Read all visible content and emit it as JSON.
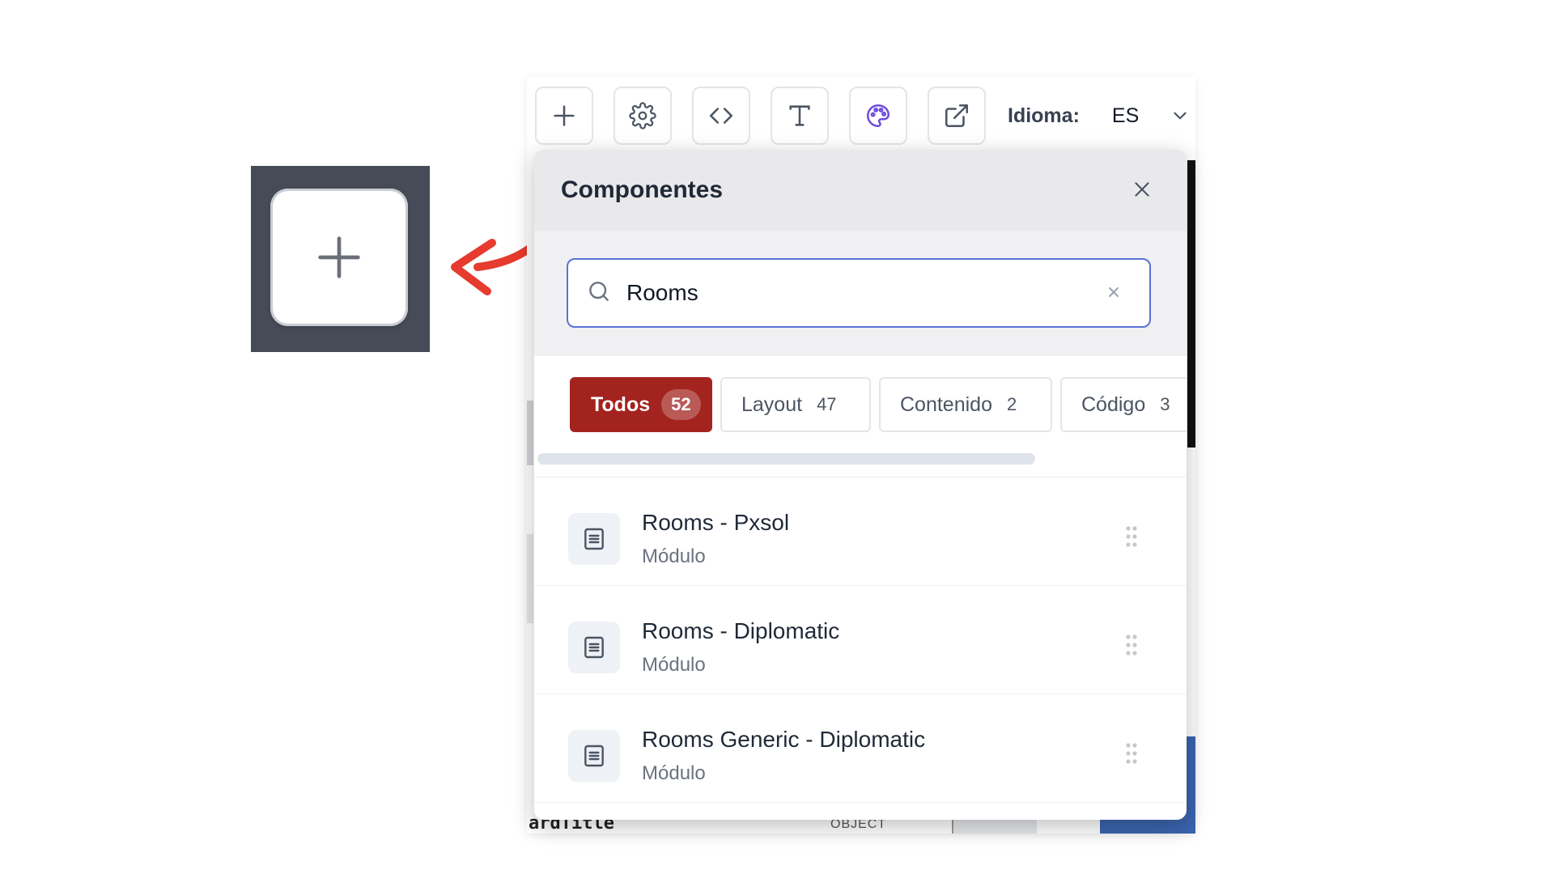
{
  "toolbar": {
    "buttons": [
      {
        "name": "add",
        "icon": "plus-icon"
      },
      {
        "name": "settings",
        "icon": "gear-icon"
      },
      {
        "name": "code",
        "icon": "code-icon"
      },
      {
        "name": "text",
        "icon": "text-icon"
      },
      {
        "name": "theme",
        "icon": "palette-icon",
        "accent": "#6d4ee0"
      },
      {
        "name": "open-external",
        "icon": "external-link-icon"
      }
    ],
    "language_label": "Idioma:",
    "language_value": "ES"
  },
  "panel": {
    "title": "Componentes",
    "search": {
      "value": "Rooms",
      "placeholder": ""
    },
    "tabs": [
      {
        "label": "Todos",
        "count": "52",
        "active": true
      },
      {
        "label": "Layout",
        "count": "47",
        "active": false
      },
      {
        "label": "Contenido",
        "count": "2",
        "active": false
      },
      {
        "label": "Código",
        "count": "3",
        "active": false
      }
    ],
    "items": [
      {
        "title": "Rooms - Pxsol",
        "subtitle": "Módulo"
      },
      {
        "title": "Rooms - Diplomatic",
        "subtitle": "Módulo"
      },
      {
        "title": "Rooms Generic - Diplomatic",
        "subtitle": "Módulo"
      }
    ]
  },
  "background": {
    "code_text": "ardTitle",
    "type_text": "OBJECT"
  },
  "colors": {
    "active_tab": "#a3231f",
    "search_border": "#5b72d4",
    "arrow": "#e63b2e",
    "callout_bg": "#474b57"
  }
}
